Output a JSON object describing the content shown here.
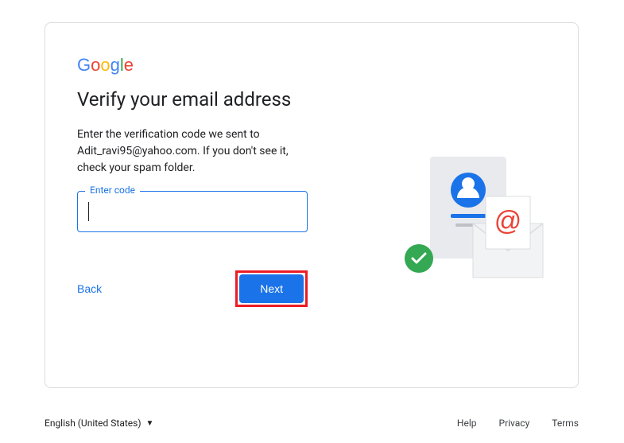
{
  "logo": {
    "g1": "G",
    "o1": "o",
    "o2": "o",
    "g2": "g",
    "l": "l",
    "e": "e"
  },
  "logoColors": {
    "g1": "#4285F4",
    "o1": "#EA4335",
    "o2": "#FBBC05",
    "g2": "#4285F4",
    "l": "#34A853",
    "e": "#EA4335"
  },
  "heading": "Verify your email address",
  "bodyText": "Enter the verification code we sent to Adit_ravi95@yahoo.com. If you don't see it, check your spam folder.",
  "email": "Adit_ravi95@yahoo.com",
  "input": {
    "label": "Enter code",
    "value": ""
  },
  "buttons": {
    "back": "Back",
    "next": "Next"
  },
  "highlight": {
    "nextButton": true
  },
  "footer": {
    "language": "English (United States)",
    "links": {
      "help": "Help",
      "privacy": "Privacy",
      "terms": "Terms"
    }
  },
  "accentColor": "#1a73e8"
}
